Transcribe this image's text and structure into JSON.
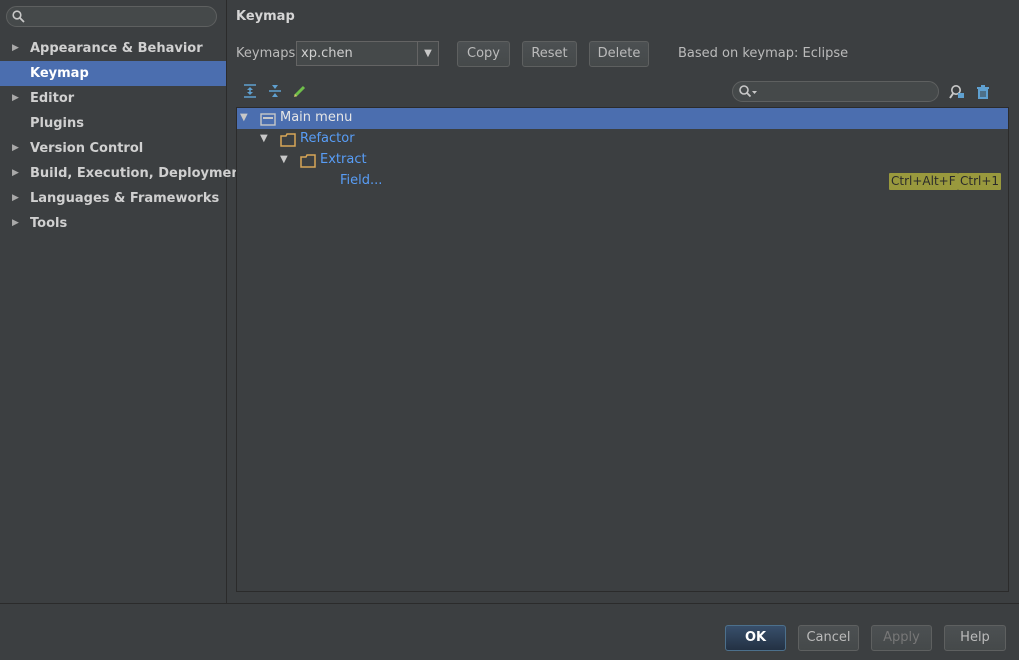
{
  "sidebar": {
    "search": {
      "value": "",
      "placeholder": ""
    },
    "items": [
      {
        "label": "Appearance & Behavior",
        "expandable": true
      },
      {
        "label": "Keymap",
        "expandable": false
      },
      {
        "label": "Editor",
        "expandable": true
      },
      {
        "label": "Plugins",
        "expandable": false
      },
      {
        "label": "Version Control",
        "expandable": true
      },
      {
        "label": "Build, Execution, Deployment",
        "expandable": true
      },
      {
        "label": "Languages & Frameworks",
        "expandable": true
      },
      {
        "label": "Tools",
        "expandable": true
      }
    ],
    "selected_index": 1
  },
  "keymap": {
    "title": "Keymap",
    "keymaps_label": "Keymaps:",
    "selected_keymap": "xp.chen",
    "copy_label": "Copy",
    "reset_label": "Reset",
    "delete_label": "Delete",
    "based_on": "Based on keymap: Eclipse",
    "filter": {
      "value": ""
    },
    "tree": {
      "main_menu": "Main menu",
      "refactor": "Refactor",
      "extract": "Extract",
      "field": "Field...",
      "shortcuts": [
        "Ctrl+Alt+F",
        "Ctrl+1"
      ]
    }
  },
  "dialog": {
    "ok_label": "OK",
    "cancel_label": "Cancel",
    "apply_label": "Apply",
    "help_label": "Help"
  },
  "colors": {
    "background": "#3c3f41",
    "selection": "#4b6eaf",
    "link_blue": "#589df6",
    "shortcut_badge": "#99993d"
  }
}
